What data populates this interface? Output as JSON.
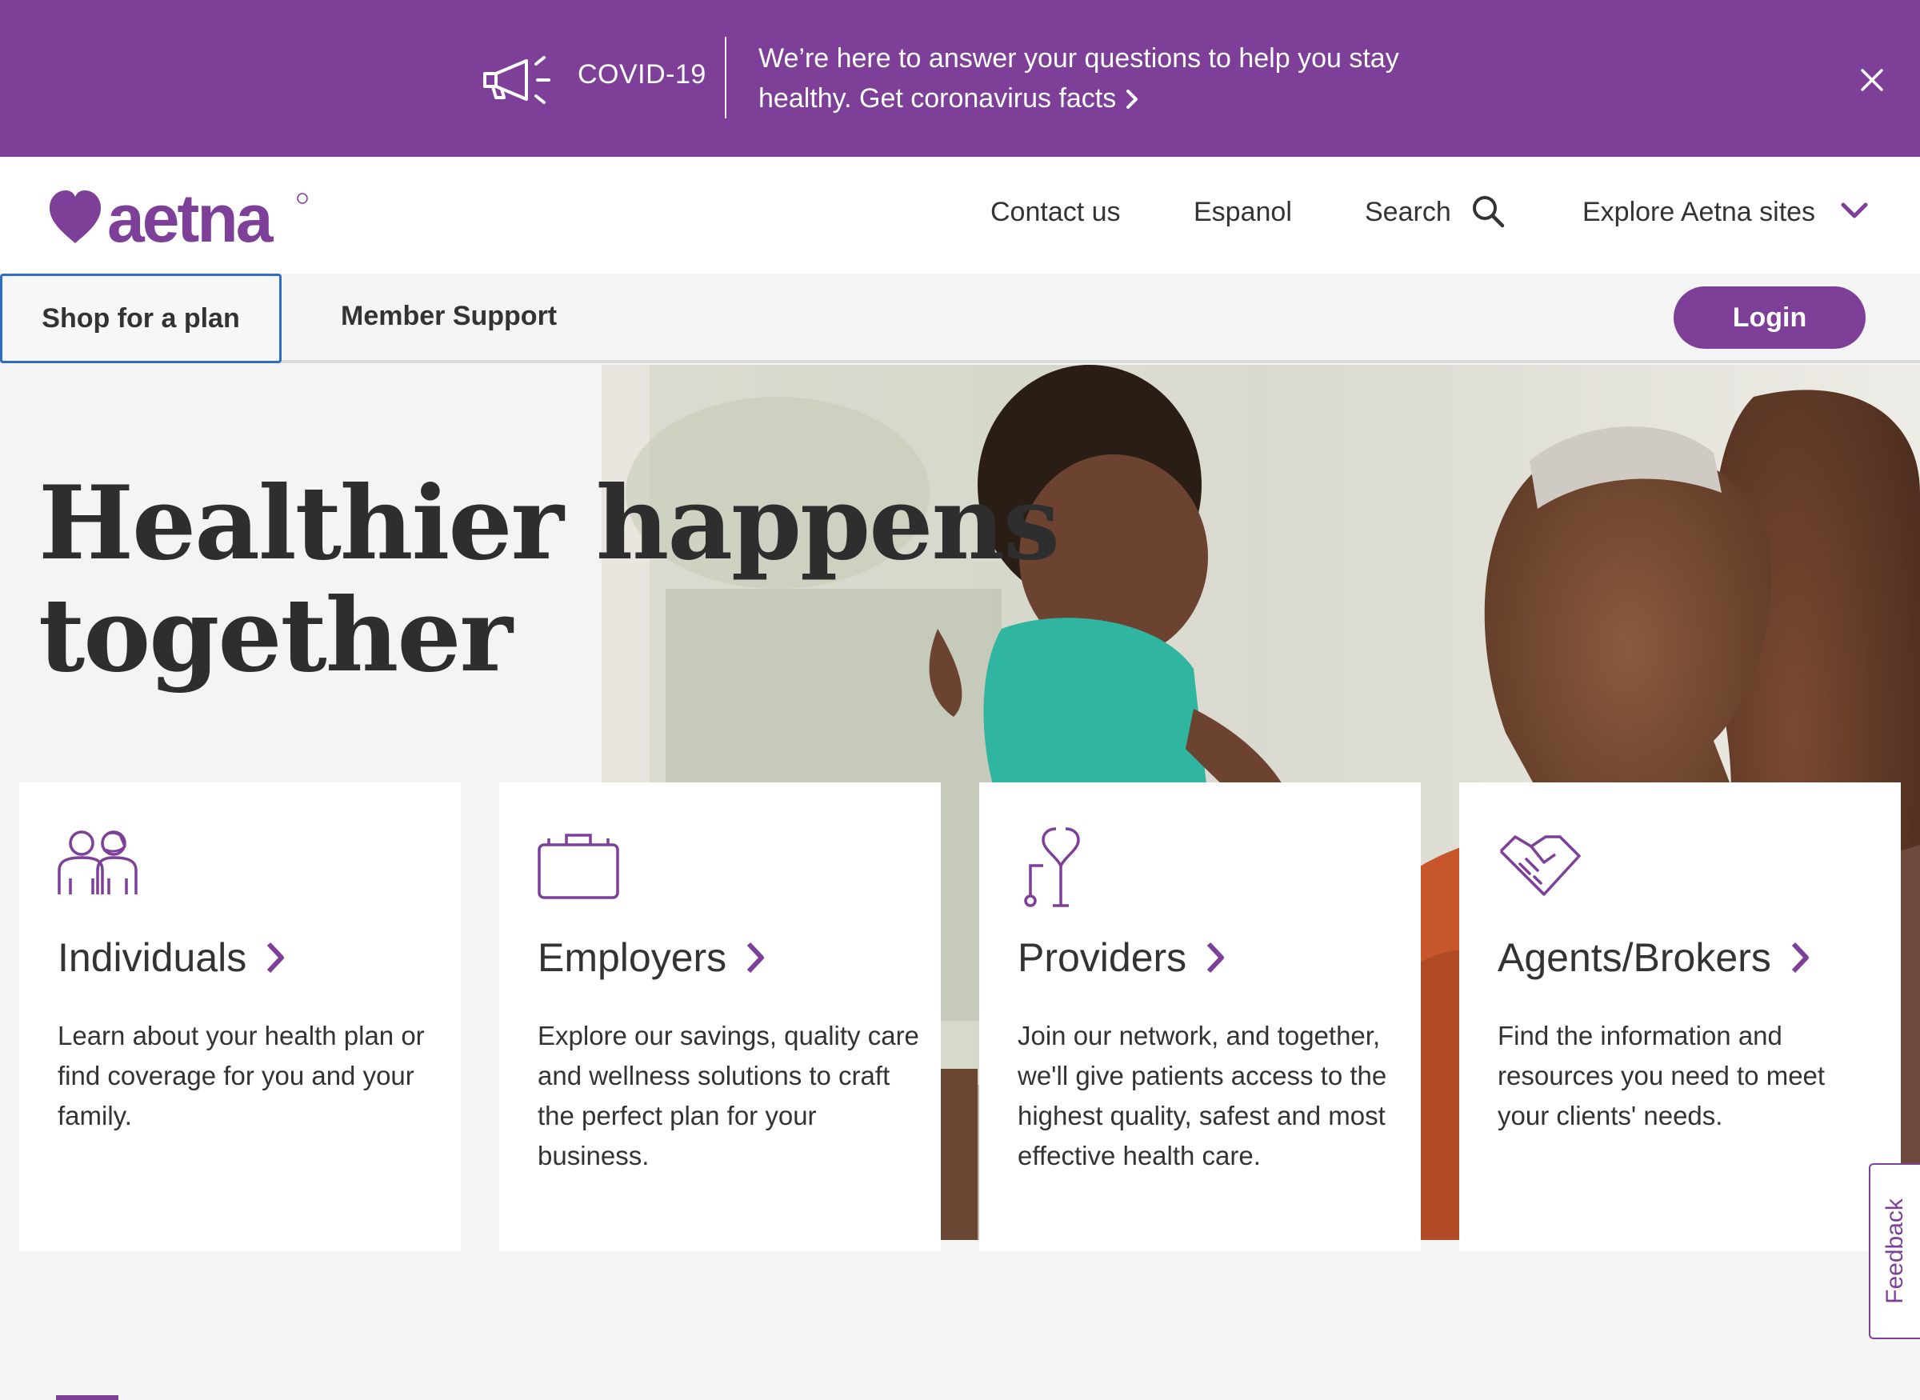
{
  "banner": {
    "covid_label": "COVID-19",
    "message_line1": "We’re here to answer your questions to help you stay",
    "message_line2": "healthy. Get coronavirus facts",
    "close_icon": "close-icon",
    "megaphone_icon": "megaphone-icon"
  },
  "header": {
    "logo_text": "aetna",
    "contact": "Contact us",
    "espanol": "Espanol",
    "search": "Search",
    "explore": "Explore Aetna sites"
  },
  "nav": {
    "shop": "Shop for a plan",
    "member": "Member Support",
    "login": "Login"
  },
  "hero": {
    "title_line1": "Healthier happens",
    "title_line2": "together"
  },
  "cards": [
    {
      "title": "Individuals",
      "desc": "Learn about your health plan or find coverage for you and your family.",
      "icon": "people-icon"
    },
    {
      "title": "Employers",
      "desc": "Explore our savings, quality care and wellness solutions to craft the perfect plan for your business.",
      "icon": "briefcase-icon"
    },
    {
      "title": "Providers",
      "desc": "Join our network, and together, we'll give patients access to the highest quality, safest and most effective health care.",
      "icon": "stethoscope-icon"
    },
    {
      "title": "Agents/Brokers",
      "desc": "Find the information and resources you need to meet your clients' needs.",
      "icon": "handshake-icon"
    }
  ],
  "feedback": "Feedback",
  "colors": {
    "brand_purple": "#7d3f98",
    "text": "#333333",
    "background": "#f4f4f4",
    "focus_blue": "#2f6cc2"
  }
}
